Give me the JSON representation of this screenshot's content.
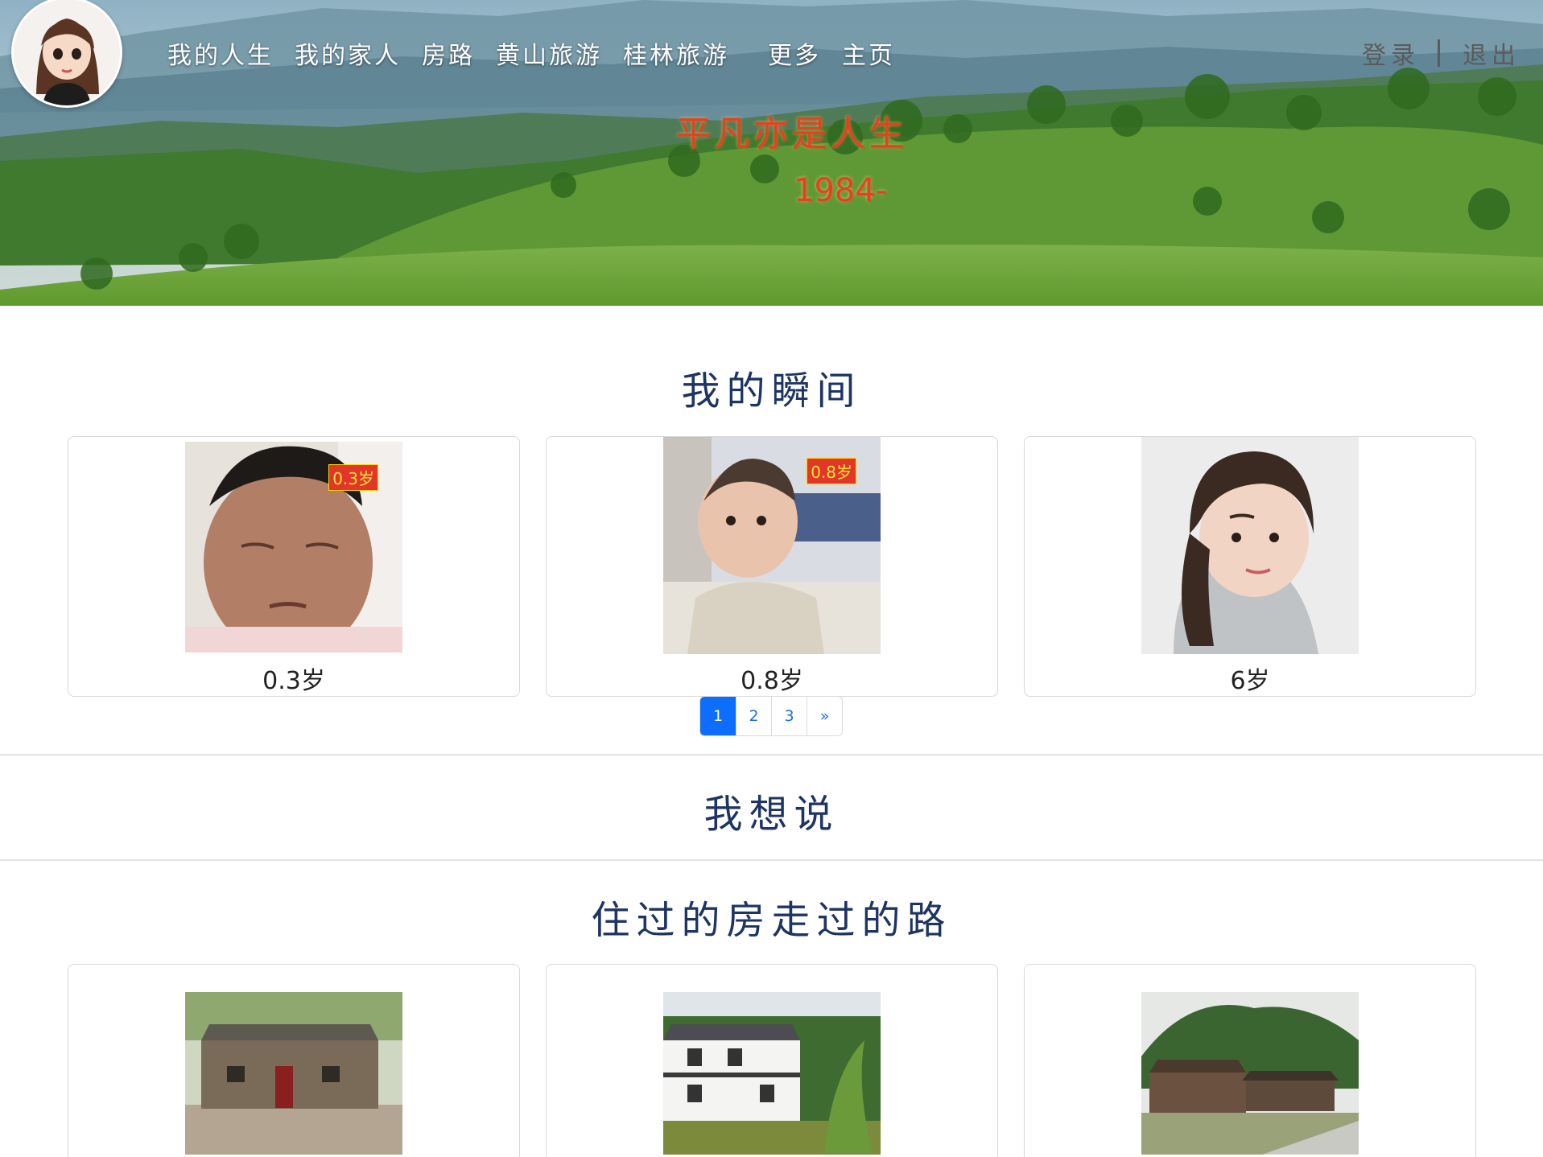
{
  "nav": {
    "items": [
      "我的人生",
      "我的家人",
      "房路",
      "黄山旅游",
      "桂林旅游"
    ],
    "more": "更多",
    "home": "主页"
  },
  "auth": {
    "login": "登录",
    "logout": "退出"
  },
  "banner": {
    "motto": "平凡亦是人生",
    "years": "1984-"
  },
  "moments": {
    "title": "我的瞬间",
    "cards": [
      {
        "caption": "0.3岁",
        "badge": "0.3岁"
      },
      {
        "caption": "0.8岁",
        "badge": "0.8岁"
      },
      {
        "caption": "6岁"
      }
    ],
    "pages": [
      "1",
      "2",
      "3",
      "»"
    ],
    "active_page": "1"
  },
  "say": {
    "title": "我想说"
  },
  "houses": {
    "title": "住过的房走过的路"
  },
  "colors": {
    "title": "#1e3463",
    "motto": "#e8401f",
    "pager_active": "#0d6efd"
  }
}
